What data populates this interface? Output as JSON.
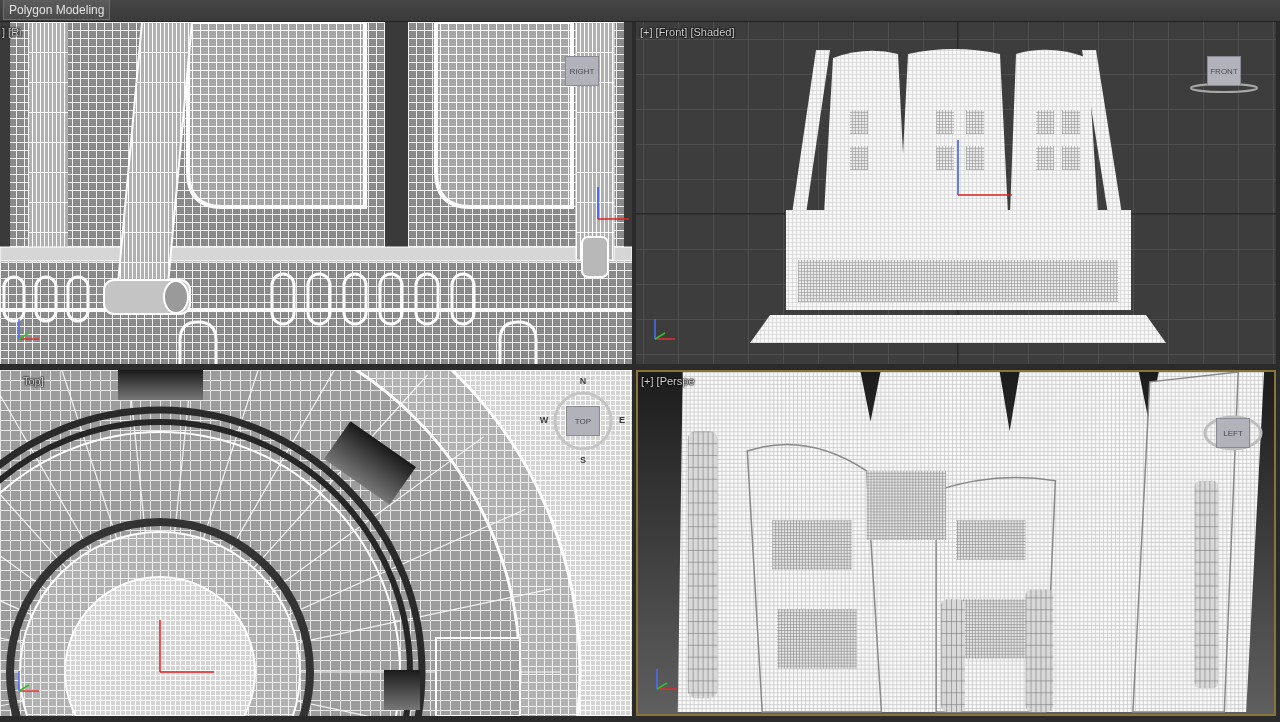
{
  "ribbon": {
    "tab": "Polygon Modeling"
  },
  "viewports": [
    {
      "kind": "right",
      "label": "] [Ri",
      "active": false,
      "view_cube": {
        "label": "RIGHT"
      }
    },
    {
      "kind": "front",
      "label": "[+] [Front] [Shaded]",
      "active": false,
      "view_cube": {
        "label": "FRONT"
      }
    },
    {
      "kind": "top",
      "label": "Top]",
      "active": false,
      "view_cube": {
        "label": "TOP",
        "compass": [
          "N",
          "E",
          "S",
          "W"
        ]
      }
    },
    {
      "kind": "perspective",
      "label": "[+] [Perspe",
      "active": true,
      "view_cube": {
        "label": "LEFT"
      }
    }
  ]
}
